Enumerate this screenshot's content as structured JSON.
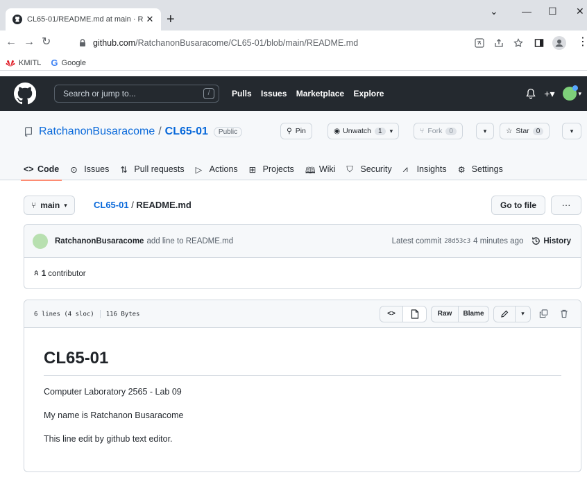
{
  "browser": {
    "tab_title": "CL65-01/README.md at main · R",
    "new_tab": "+",
    "url_host": "github.com",
    "url_path": "/RatchanonBusaracome/CL65-01/blob/main/README.md",
    "bookmarks": [
      {
        "label": "KMITL",
        "icon": "huawei-icon"
      },
      {
        "label": "Google",
        "icon": "google-icon"
      }
    ],
    "window_controls": [
      "⌄",
      "—",
      "☐",
      "✕"
    ]
  },
  "gh_header": {
    "search_placeholder": "Search or jump to...",
    "search_shortcut": "/",
    "nav": [
      "Pulls",
      "Issues",
      "Marketplace",
      "Explore"
    ],
    "plus": "+▾"
  },
  "repo": {
    "owner": "RatchanonBusaracome",
    "separator": "/",
    "name": "CL65-01",
    "visibility": "Public",
    "pin_label": "Pin",
    "unwatch_label": "Unwatch",
    "watch_count": "1",
    "fork_label": "Fork",
    "fork_count": "0",
    "star_label": "Star",
    "star_count": "0",
    "tabs": [
      "Code",
      "Issues",
      "Pull requests",
      "Actions",
      "Projects",
      "Wiki",
      "Security",
      "Insights",
      "Settings"
    ],
    "selected_tab": "Code"
  },
  "file_nav": {
    "branch": "main",
    "crumb_repo": "CL65-01",
    "crumb_sep": " / ",
    "crumb_file": "README.md",
    "goto_label": "Go to file",
    "more_label": "···"
  },
  "commit": {
    "author": "RatchanonBusaracome",
    "message": "add line to README.md",
    "latest_label": "Latest commit",
    "sha": "28d53c3",
    "time": "4 minutes ago",
    "history_label": "History",
    "contributors_count": "1",
    "contributors_label": "contributor"
  },
  "file": {
    "lines_info": "6 lines (4 sloc)",
    "size_info": "116 Bytes",
    "raw_label": "Raw",
    "blame_label": "Blame"
  },
  "readme": {
    "heading": "CL65-01",
    "paragraphs": [
      "Computer Laboratory 2565 - Lab 09",
      "My name is Ratchanon Busaracome",
      "This line edit by github text editor."
    ]
  },
  "colors": {
    "gh_header_bg": "#24292f",
    "link_blue": "#0969da",
    "tab_underline": "#fd8c73"
  }
}
